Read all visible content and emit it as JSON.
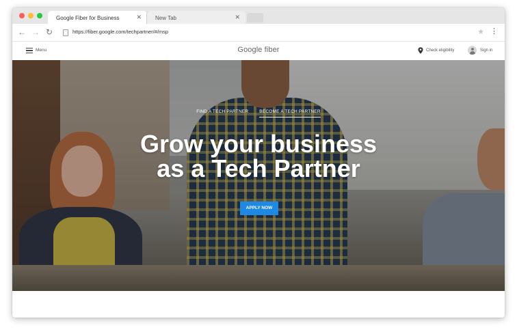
{
  "browser": {
    "tabs": [
      {
        "label": "Google Fiber for Business",
        "active": true
      },
      {
        "label": "New Tab",
        "active": false
      }
    ],
    "url": "https://fiber.google.com/techpartner/#/msp",
    "icons": {
      "close": "close-icon",
      "back": "back-arrow-icon",
      "forward": "forward-arrow-icon",
      "reload": "reload-icon",
      "star": "star-icon",
      "menu": "kebab-menu-icon",
      "page": "page-icon"
    }
  },
  "header": {
    "menu_label": "Menu",
    "brand": "Google fiber",
    "check_eligibility": "Check eligibility",
    "sign_in": "Sign in"
  },
  "hero": {
    "nav": [
      {
        "label": "FIND A TECH PARTNER",
        "active": false
      },
      {
        "label": "BECOME A TECH PARTNER",
        "active": true
      }
    ],
    "title_line1": "Grow your business",
    "title_line2": "as a Tech Partner",
    "cta": "APPLY NOW"
  },
  "colors": {
    "cta_blue": "#1e88e5",
    "traffic_red": "#ff5f57",
    "traffic_yellow": "#febc2e",
    "traffic_green": "#28c840"
  }
}
